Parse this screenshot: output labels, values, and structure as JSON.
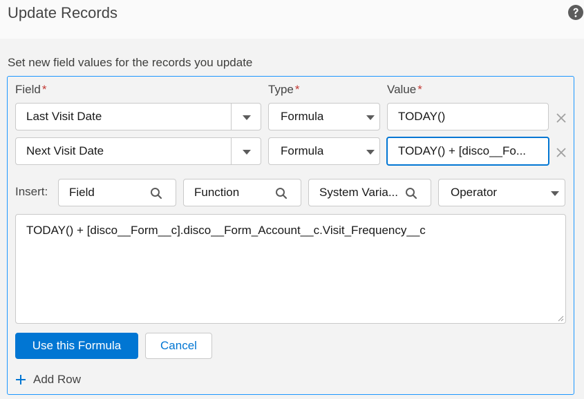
{
  "header": {
    "title": "Update Records"
  },
  "subtitle": "Set new field values for the records you update",
  "columns": {
    "field": "Field",
    "type": "Type",
    "value": "Value",
    "required_mark": "*"
  },
  "rows": [
    {
      "field": "Last Visit Date",
      "type": "Formula",
      "value": "TODAY()"
    },
    {
      "field": "Next Visit Date",
      "type": "Formula",
      "value": "TODAY() + [disco__Fo..."
    }
  ],
  "insert": {
    "label": "Insert:",
    "field": "Field",
    "function": "Function",
    "system_variable": "System Varia...",
    "operator": "Operator"
  },
  "formula": "TODAY() + [disco__Form__c].disco__Form_Account__c.Visit_Frequency__c",
  "buttons": {
    "use_formula": "Use this Formula",
    "cancel": "Cancel",
    "add_row": "Add Row"
  },
  "colors": {
    "brand": "#0176d3",
    "required": "#c23934",
    "focus": "#1b96ff"
  }
}
